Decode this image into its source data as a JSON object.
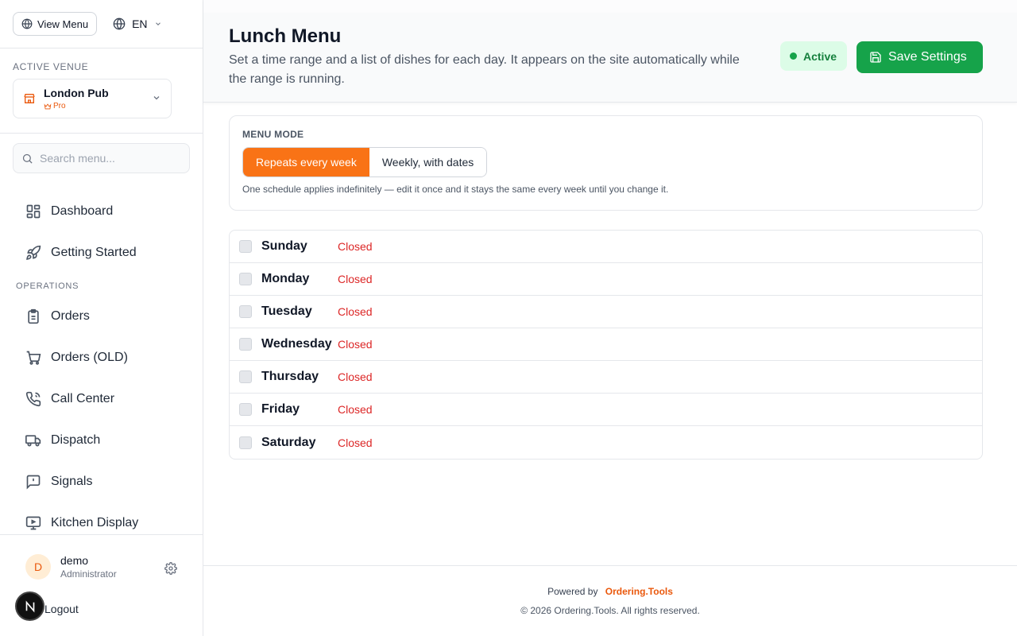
{
  "colors": {
    "accent": "#f97316",
    "success": "#16a34a",
    "danger": "#dc2626"
  },
  "top_bar": {
    "view_menu_label": "View Menu",
    "language": "EN"
  },
  "venue": {
    "section_label": "ACTIVE VENUE",
    "name": "London Pub",
    "plan": "Pro"
  },
  "search": {
    "placeholder": "Search menu..."
  },
  "sidebar": {
    "items_top": [
      {
        "label": "Dashboard",
        "icon": "dashboard-icon"
      },
      {
        "label": "Getting Started",
        "icon": "rocket-icon"
      }
    ],
    "operations_label": "OPERATIONS",
    "items_ops": [
      {
        "label": "Orders",
        "icon": "clipboard-icon"
      },
      {
        "label": "Orders (OLD)",
        "icon": "cart-icon"
      },
      {
        "label": "Call Center",
        "icon": "phone-icon"
      },
      {
        "label": "Dispatch",
        "icon": "truck-icon"
      },
      {
        "label": "Signals",
        "icon": "alert-message-icon"
      },
      {
        "label": "Kitchen Display",
        "icon": "monitor-icon"
      }
    ]
  },
  "user": {
    "initial": "D",
    "name": "demo",
    "role": "Administrator",
    "logout_label": "Logout"
  },
  "header": {
    "title": "Lunch Menu",
    "description": "Set a time range and a list of dishes for each day. It appears on the site automatically while the range is running.",
    "status": "Active",
    "save_label": "Save Settings"
  },
  "menu_mode": {
    "label": "MENU MODE",
    "options": [
      "Repeats every week",
      "Weekly, with dates"
    ],
    "selected": "Repeats every week",
    "help": "One schedule applies indefinitely — edit it once and it stays the same every week until you change it."
  },
  "days": [
    {
      "name": "Sunday",
      "status": "Closed",
      "checked": false
    },
    {
      "name": "Monday",
      "status": "Closed",
      "checked": false
    },
    {
      "name": "Tuesday",
      "status": "Closed",
      "checked": false
    },
    {
      "name": "Wednesday",
      "status": "Closed",
      "checked": false
    },
    {
      "name": "Thursday",
      "status": "Closed",
      "checked": false
    },
    {
      "name": "Friday",
      "status": "Closed",
      "checked": false
    },
    {
      "name": "Saturday",
      "status": "Closed",
      "checked": false
    }
  ],
  "footer": {
    "powered_by": "Powered by",
    "brand": "Ordering.Tools",
    "copyright": "© 2026 Ordering.Tools. All rights reserved."
  }
}
